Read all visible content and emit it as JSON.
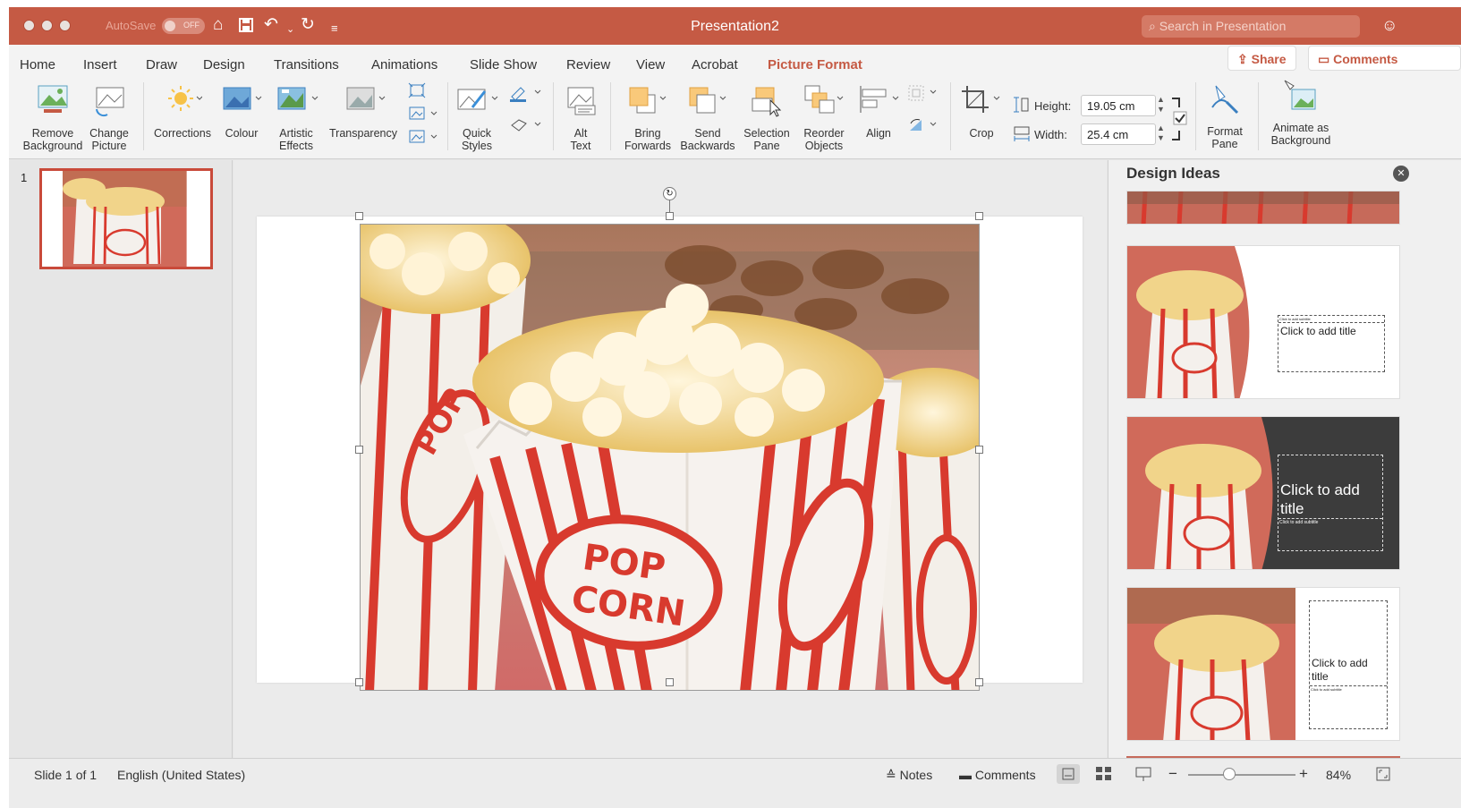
{
  "window": {
    "title": "Presentation2",
    "autosave_label": "AutoSave",
    "autosave_state": "OFF",
    "search_placeholder": "Search in Presentation"
  },
  "tabs": [
    {
      "label": "Home"
    },
    {
      "label": "Insert"
    },
    {
      "label": "Draw"
    },
    {
      "label": "Design"
    },
    {
      "label": "Transitions"
    },
    {
      "label": "Animations"
    },
    {
      "label": "Slide Show"
    },
    {
      "label": "Review"
    },
    {
      "label": "View"
    },
    {
      "label": "Acrobat"
    },
    {
      "label": "Picture Format",
      "active": true
    }
  ],
  "actions": {
    "share": "Share",
    "comments": "Comments"
  },
  "ribbon": {
    "remove_bg": [
      "Remove",
      "Background"
    ],
    "change_picture": [
      "Change",
      "Picture"
    ],
    "corrections": "Corrections",
    "colour": "Colour",
    "artistic": [
      "Artistic",
      "Effects"
    ],
    "transparency": "Transparency",
    "quick_styles": [
      "Quick",
      "Styles"
    ],
    "alt_text": [
      "Alt",
      "Text"
    ],
    "bring_forwards": [
      "Bring",
      "Forwards"
    ],
    "send_backwards": [
      "Send",
      "Backwards"
    ],
    "selection_pane": [
      "Selection",
      "Pane"
    ],
    "reorder": [
      "Reorder",
      "Objects"
    ],
    "align": "Align",
    "crop": "Crop",
    "height_label": "Height:",
    "height_value": "19.05 cm",
    "width_label": "Width:",
    "width_value": "25.4 cm",
    "format_pane": [
      "Format",
      "Pane"
    ],
    "animate_bg": [
      "Animate as",
      "Background"
    ]
  },
  "slides_panel": {
    "slide_number": "1"
  },
  "picture": {
    "text_top": "POP",
    "text_bottom": "CORN"
  },
  "design_ideas": {
    "title": "Design Ideas",
    "placeholder_title": "Click to add title",
    "placeholder_subtitle": "Click to add subtitle"
  },
  "status": {
    "slide_info": "Slide 1 of 1",
    "language": "English (United States)",
    "notes": "Notes",
    "comments": "Comments",
    "zoom": "84%"
  },
  "colors": {
    "accent": "#c55a44",
    "popcorn_red": "#d83a2e"
  }
}
